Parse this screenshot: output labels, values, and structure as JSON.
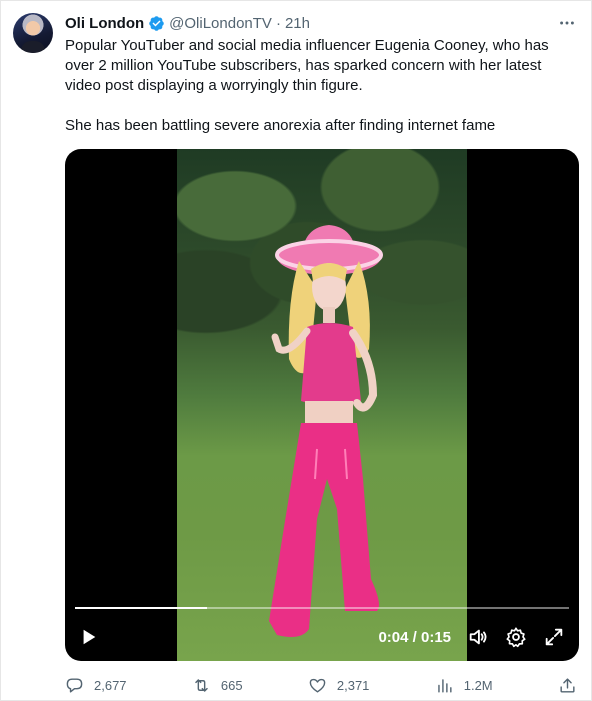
{
  "tweet": {
    "author_name": "Oli London",
    "handle": "@OliLondonTV",
    "separator": "·",
    "time": "21h",
    "paragraphs": [
      "Popular YouTuber and social media influencer Eugenia Cooney, who has over 2 million YouTube subscribers, has sparked concern with her latest video post displaying a worryingly thin figure.",
      "She has been battling severe anorexia after finding internet fame"
    ]
  },
  "video": {
    "timecode": "0:04 / 0:15",
    "progress_fraction": 0.267
  },
  "actions": {
    "replies": "2,677",
    "retweets": "665",
    "likes": "2,371",
    "views": "1.2M"
  },
  "icons": {
    "verified": "verified-badge-icon",
    "more": "more-dots-icon",
    "reply": "reply-icon",
    "retweet": "retweet-icon",
    "like": "heart-icon",
    "views": "views-bar-chart-icon",
    "share": "share-icon",
    "play": "play-icon",
    "volume": "volume-icon",
    "settings": "settings-gear-icon",
    "fullscreen": "fullscreen-icon"
  },
  "colors": {
    "verified_blue": "#1d9bf0",
    "secondary_text": "#536471",
    "outfit_pink": "#ea2f86"
  }
}
